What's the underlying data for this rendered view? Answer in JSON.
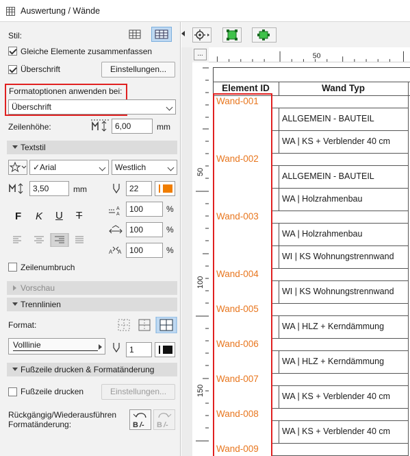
{
  "window": {
    "title": "Auswertung /  Wände"
  },
  "left": {
    "stil_label": "Stil:",
    "gleiche_label": "Gleiche Elemente zusammenfassen",
    "ueberschrift_label": "Überschrift",
    "einstellungen_button": "Einstellungen...",
    "formatoptionen_label": "Formatoptionen anwenden bei:",
    "formatoptionen_value": "Überschrift",
    "zeilenhoehe_label": "Zeilenhöhe:",
    "zeilenhoehe_value": "6,00",
    "zeilenhoehe_unit": "mm",
    "textstil_section": "Textstil",
    "font_value": "✓Arial",
    "script_value": "Westlich",
    "size_value": "3,50",
    "size_unit": "mm",
    "pen_value": "22",
    "scale1_value": "100",
    "scale2_value": "100",
    "scale3_value": "100",
    "percent": "%",
    "bold_glyph": "F",
    "italic_glyph": "K",
    "underline_glyph": "U",
    "strike_glyph": "T",
    "zeilenumbruch_label": "Zeilenumbruch",
    "vorschau_section": "Vorschau",
    "trennlinien_section": "Trennlinien",
    "format_label": "Format:",
    "line_type_value": "Volllinie",
    "line_pen_value": "1",
    "fusszeile_section": "Fußzeile drucken & Formatänderung",
    "fusszeile_label": "Fußzeile drucken",
    "einstellungen2_button": "Einstellungen...",
    "undo_label_1": "Rückgängig/Wiederausführen",
    "undo_label_2": "Formatänderung:"
  },
  "ruler": {
    "mark_50_h": "50",
    "mark_50_v": "50",
    "mark_100_v": "100",
    "mark_150_v": "150",
    "dots": "..."
  },
  "table": {
    "headers": [
      "Element ID",
      "Wand Typ"
    ],
    "groups": [
      {
        "id": "Wand-001",
        "types": [
          "ALLGEMEIN - BAUTEIL",
          "WA | KS + Verblender 40 cm"
        ]
      },
      {
        "id": "Wand-002",
        "types": [
          "ALLGEMEIN - BAUTEIL",
          "WA | Holzrahmenbau"
        ]
      },
      {
        "id": "Wand-003",
        "types": [
          "WA | Holzrahmenbau",
          "WI | KS Wohnungstrennwand"
        ]
      },
      {
        "id": "Wand-004",
        "types": [
          "WI | KS Wohnungstrennwand"
        ]
      },
      {
        "id": "Wand-005",
        "types": [
          "WA | HLZ + Kerndämmung"
        ]
      },
      {
        "id": "Wand-006",
        "types": [
          "WA | HLZ + Kerndämmung"
        ]
      },
      {
        "id": "Wand-007",
        "types": [
          "WA | KS + Verblender 40 cm"
        ]
      },
      {
        "id": "Wand-008",
        "types": [
          "WA | KS + Verblender 40 cm"
        ]
      },
      {
        "id": "Wand-009",
        "types": []
      }
    ]
  },
  "colors": {
    "id_text": "#e8761e",
    "highlight_border": "#e02020",
    "selected_button": "#bfd9f2",
    "pen_orange": "#f07d00"
  }
}
